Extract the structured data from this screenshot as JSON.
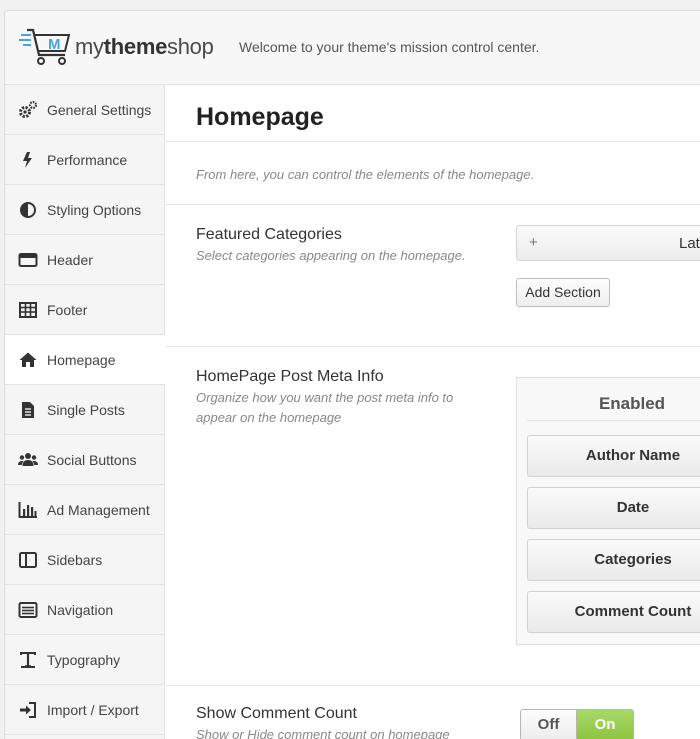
{
  "brand": {
    "name_light1": "my",
    "name_bold": "theme",
    "name_light2": "shop"
  },
  "header": {
    "welcome": "Welcome to your theme's mission control center."
  },
  "sidebar": {
    "items": [
      {
        "label": "General Settings",
        "icon": "gears-icon"
      },
      {
        "label": "Performance",
        "icon": "bolt-icon"
      },
      {
        "label": "Styling Options",
        "icon": "contrast-icon"
      },
      {
        "label": "Header",
        "icon": "header-icon"
      },
      {
        "label": "Footer",
        "icon": "table-icon"
      },
      {
        "label": "Homepage",
        "icon": "home-icon",
        "active": true
      },
      {
        "label": "Single Posts",
        "icon": "document-icon"
      },
      {
        "label": "Social Buttons",
        "icon": "users-icon"
      },
      {
        "label": "Ad Management",
        "icon": "bar-chart-icon"
      },
      {
        "label": "Sidebars",
        "icon": "columns-icon"
      },
      {
        "label": "Navigation",
        "icon": "list-icon"
      },
      {
        "label": "Typography",
        "icon": "text-icon"
      },
      {
        "label": "Import / Export",
        "icon": "sign-in-icon"
      }
    ]
  },
  "main": {
    "title": "Homepage",
    "intro": "From here, you can control the elements of the homepage.",
    "featured": {
      "title": "Featured Categories",
      "desc": "Select categories appearing on the homepage.",
      "accordion_plus": "+",
      "accordion_label": "Lat",
      "add_button": "Add Section"
    },
    "meta": {
      "title": "HomePage Post Meta Info",
      "desc": "Organize how you want the post meta info to appear on the homepage",
      "enabled_heading": "Enabled",
      "items": [
        "Author Name",
        "Date",
        "Categories",
        "Comment Count"
      ]
    },
    "comment_count": {
      "title": "Show Comment Count",
      "desc": "Show or Hide comment count on homepage",
      "off_label": "Off",
      "on_label": "On",
      "on_color": "#8cc43f"
    }
  }
}
